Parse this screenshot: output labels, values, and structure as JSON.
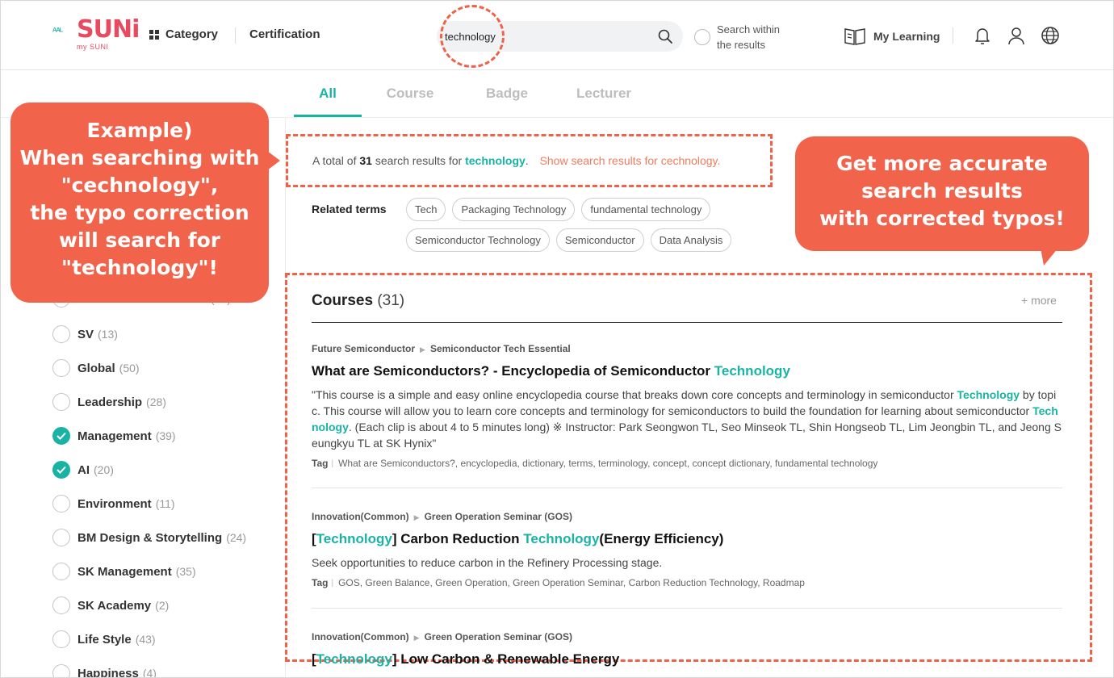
{
  "brand": {
    "logo_text": "SUNi",
    "logo_sub": "my SUNI",
    "logo_prefix": "ᴬᴬᴸ"
  },
  "header": {
    "category_label": "Category",
    "certification_label": "Certification",
    "search_value": "technology",
    "within_label": "Search within the results",
    "my_learning_label": "My Learning"
  },
  "tabs": [
    {
      "label": "All",
      "active": true
    },
    {
      "label": "Course",
      "active": false
    },
    {
      "label": "Badge",
      "active": false
    },
    {
      "label": "Lecturer",
      "active": false
    }
  ],
  "summary": {
    "prefix": "A total of",
    "count": "31",
    "middle": "search results for",
    "keyword": "technology",
    "period": ".",
    "correction": "Show search results for cechnology."
  },
  "related": {
    "label": "Related terms",
    "terms": [
      "Tech",
      "Packaging Technology",
      "fundamental technology",
      "Semiconductor Technology",
      "Semiconductor",
      "Data Analysis"
    ]
  },
  "filters": [
    {
      "label": "Future Semiconductor",
      "count": "(14)",
      "checked": false
    },
    {
      "label": "SV",
      "count": "(13)",
      "checked": false
    },
    {
      "label": "Global",
      "count": "(50)",
      "checked": false
    },
    {
      "label": "Leadership",
      "count": "(28)",
      "checked": false
    },
    {
      "label": "Management",
      "count": "(39)",
      "checked": true
    },
    {
      "label": "AI",
      "count": "(20)",
      "checked": true
    },
    {
      "label": "Environment",
      "count": "(11)",
      "checked": false
    },
    {
      "label": "BM Design & Storytelling",
      "count": "(24)",
      "checked": false
    },
    {
      "label": "SK Management",
      "count": "(35)",
      "checked": false
    },
    {
      "label": "SK Academy",
      "count": "(2)",
      "checked": false
    },
    {
      "label": "Life Style",
      "count": "(43)",
      "checked": false
    },
    {
      "label": "Happiness",
      "count": "(4)",
      "checked": false
    }
  ],
  "courses": {
    "heading": "Courses",
    "count": "(31)",
    "more": "+ more",
    "tag_label": "Tag",
    "items": [
      {
        "crumb1": "Future Semiconductor",
        "crumb2": "Semiconductor Tech Essential",
        "title_parts": [
          {
            "text": "What are Semiconductors? - Encyclopedia of Semiconductor ",
            "hl": false
          },
          {
            "text": "Technology",
            "hl": true
          }
        ],
        "desc_parts": [
          {
            "text": "\"This course is a simple and easy online encyclopedia course that breaks down core concepts and terminology in semiconductor ",
            "hl": false
          },
          {
            "text": "Technology",
            "hl": true
          },
          {
            "text": " by topic. This course will allow you to learn core concepts and terminology for semiconductors to build the foundation for learning about semiconductor ",
            "hl": false
          },
          {
            "text": "Technology",
            "hl": true
          },
          {
            "text": ". (Each clip is about 4 to 5 minutes long) ※ Instructor: Park Seongwon TL, Seo Minseok TL, Shin Hongseob TL, Lim Jeongbin TL, and Jeong Seungkyu TL at SK Hynix\"",
            "hl": false
          }
        ],
        "tags": "What are Semiconductors?,  encyclopedia,  dictionary,  terms,  terminology,  concept,  concept dictionary,  fundamental technology"
      },
      {
        "crumb1": "Innovation(Common)",
        "crumb2": "Green Operation Seminar (GOS)",
        "title_parts": [
          {
            "text": "[",
            "hl": false
          },
          {
            "text": "Technology",
            "hl": true
          },
          {
            "text": "] Carbon Reduction ",
            "hl": false
          },
          {
            "text": "Technology",
            "hl": true
          },
          {
            "text": "(Energy Efficiency)",
            "hl": false
          }
        ],
        "desc_parts": [
          {
            "text": "Seek opportunities to reduce carbon in the Refinery Processing stage.",
            "hl": false
          }
        ],
        "tags": "GOS,  Green Balance,  Green Operation,  Green Operation Seminar,  Carbon Reduction Technology,  Roadmap"
      },
      {
        "crumb1": "Innovation(Common)",
        "crumb2": "Green Operation Seminar (GOS)",
        "title_parts": [
          {
            "text": "[",
            "hl": false
          },
          {
            "text": "Technology",
            "hl": true
          },
          {
            "text": "] Low Carbon & Renewable Energy",
            "hl": false
          }
        ],
        "desc_parts": [],
        "tags": ""
      }
    ]
  },
  "callouts": {
    "left": [
      "Example)",
      "When searching with",
      "\"cechnology\",",
      "the typo correction",
      "will search for",
      "\"technology\"!"
    ],
    "right": [
      "Get more accurate",
      "search results",
      "with corrected typos!"
    ]
  },
  "colors": {
    "accent": "#19b3a6",
    "callout": "#f1634a",
    "correction": "#f07c5f"
  }
}
